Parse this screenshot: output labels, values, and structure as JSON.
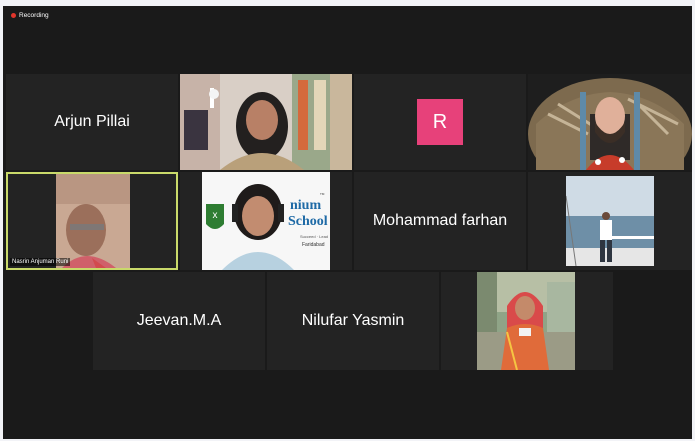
{
  "recording": {
    "label": "Recording",
    "color": "#e0352b"
  },
  "colors": {
    "tile_bg": "#232323",
    "active_border": "#c9d96a",
    "avatar_bg": "#e7417a"
  },
  "participants": [
    {
      "name": "Arjun Pillai",
      "video": false
    },
    {
      "name": "",
      "video": true
    },
    {
      "name": "",
      "video": false,
      "avatar_letter": "R"
    },
    {
      "name": "",
      "video": true
    },
    {
      "name": "Nasrin Anjuman Runi",
      "video": true,
      "active_speaker": true
    },
    {
      "name": "",
      "video": true,
      "background_text": {
        "line1": "nium",
        "line2": "School",
        "line3": "Succeed · Lead",
        "line4": "Faridabad",
        "tm": "TM"
      }
    },
    {
      "name": "Mohammad farhan",
      "video": false
    },
    {
      "name": "",
      "video": true
    },
    {
      "name": "Jeevan.M.A",
      "video": false
    },
    {
      "name": "Nilufar Yasmin",
      "video": false
    },
    {
      "name": "",
      "video": true
    }
  ]
}
